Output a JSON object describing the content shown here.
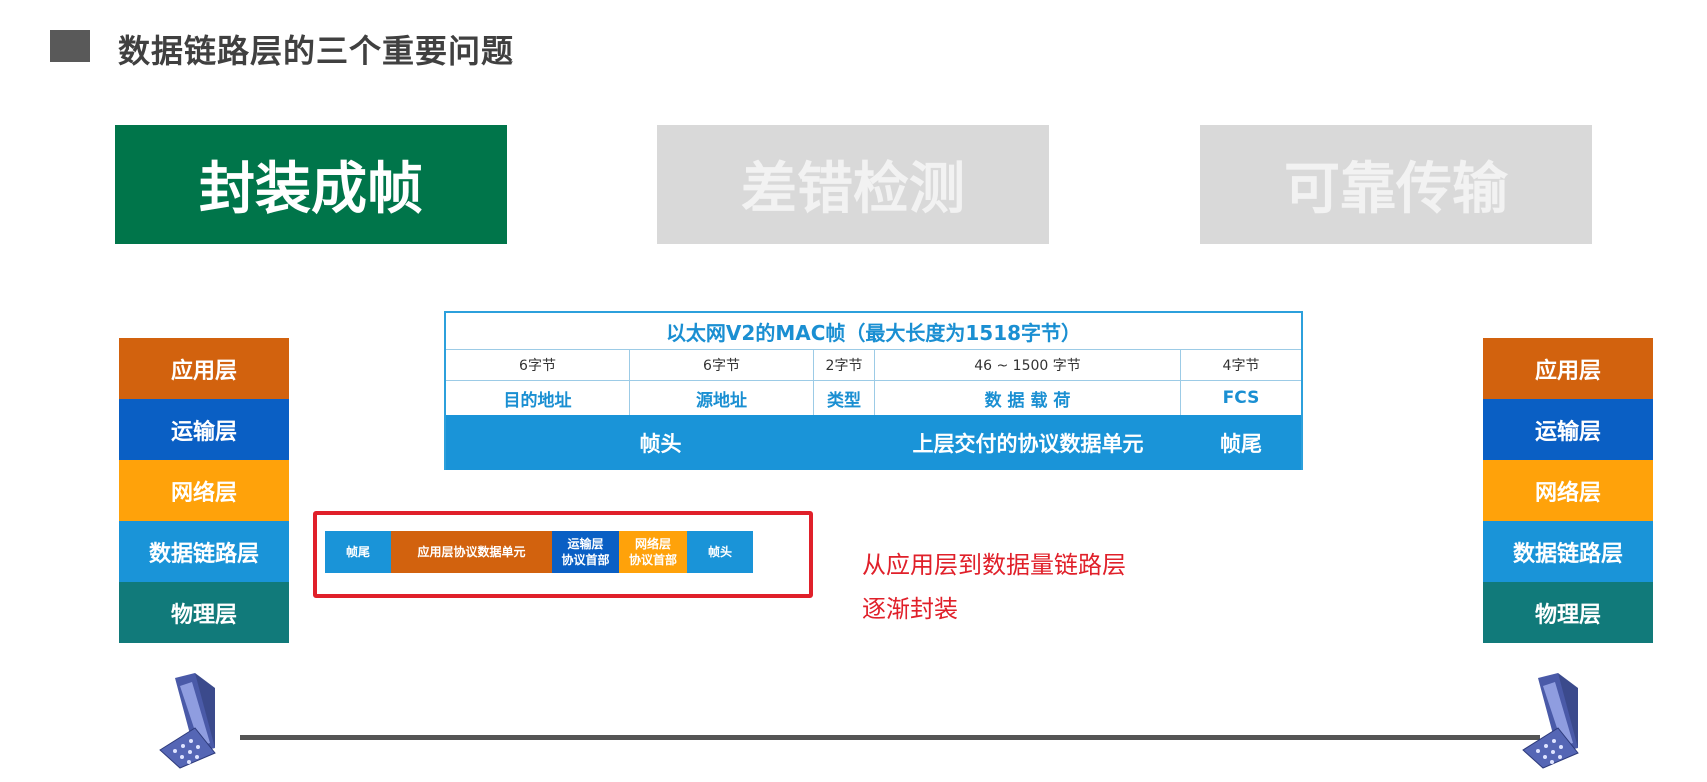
{
  "title": "数据链路层的三个重要问题",
  "topics": [
    {
      "label": "封装成帧",
      "active": true
    },
    {
      "label": "差错检测",
      "active": false
    },
    {
      "label": "可靠传输",
      "active": false
    }
  ],
  "frame_table": {
    "title": "以太网V2的MAC帧（最大长度为1518字节）",
    "sizes": [
      "6字节",
      "6字节",
      "2字节",
      "46 ~ 1500 字节",
      "4字节"
    ],
    "fields": [
      "目的地址",
      "源地址",
      "类型",
      "数 据 载 荷",
      "FCS"
    ],
    "parts": [
      "帧头",
      "上层交付的协议数据单元",
      "帧尾"
    ]
  },
  "layers": [
    "应用层",
    "运输层",
    "网络层",
    "数据链路层",
    "物理层"
  ],
  "encap_bar": [
    "帧尾",
    "应用层协议数据单元",
    "运输层\n协议首部",
    "网络层\n协议首部",
    "帧头"
  ],
  "note": [
    "从应用层到数据量链路层",
    "逐渐封装"
  ],
  "colors": {
    "green": "#00754a",
    "gray": "#d9d9d9",
    "app": "#d2620e",
    "transport": "#0a5fc4",
    "network": "#ffa20a",
    "datalink": "#1a94d8",
    "physical": "#117a7a",
    "red": "#e0202a"
  }
}
